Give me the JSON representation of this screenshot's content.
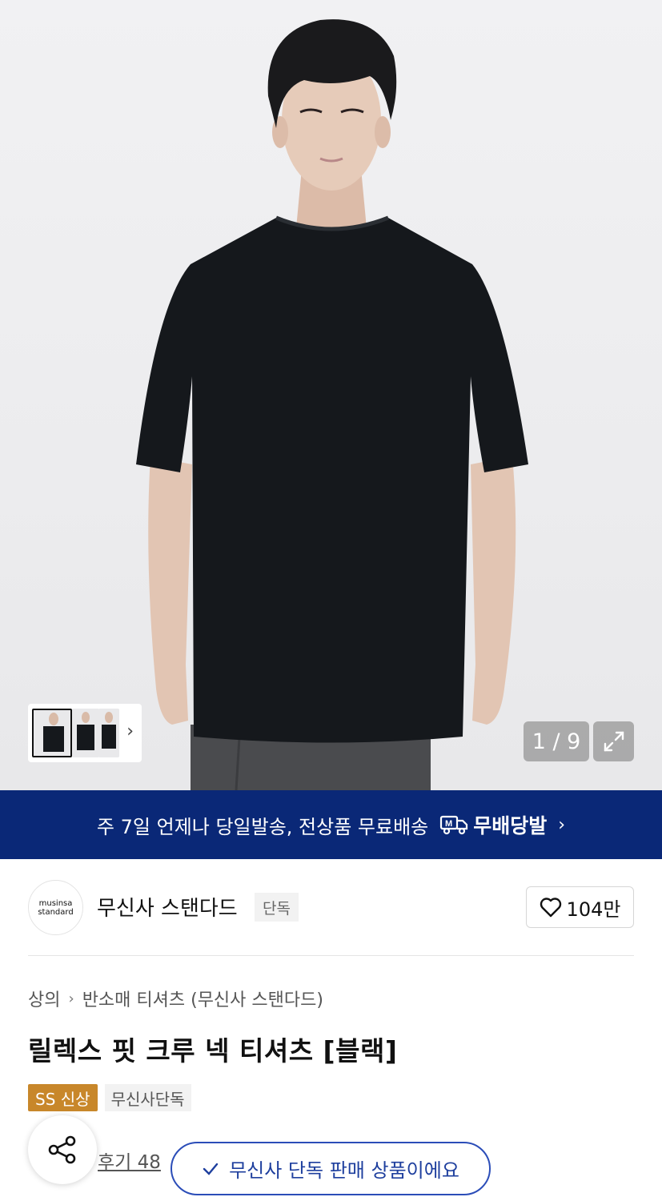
{
  "gallery": {
    "counter": "1 / 9",
    "icons": {
      "next": "chevron-right-icon",
      "expand": "expand-icon"
    }
  },
  "banner": {
    "text": "주 7일 언제나 당일발송, 전상품 무료배송",
    "badge_label": "무배당발",
    "badge_icon": "delivery-truck-icon",
    "arrow": "›",
    "bg_color": "#0a2877"
  },
  "brand": {
    "logo_line1": "musinsa",
    "logo_line2": "standard",
    "name": "무신사 스탠다드",
    "tag": "단독"
  },
  "like": {
    "icon": "heart-icon",
    "count": "104만"
  },
  "breadcrumb": {
    "root": "상의",
    "category": "반소매 티셔츠 (무신사 스탠다드)"
  },
  "product": {
    "title": "릴렉스 핏 크루 넥 티셔츠 [블랙]",
    "tags": [
      "SS 신상",
      "무신사단독"
    ],
    "new_tag_color": "#c8872a",
    "reviews": "후기 48"
  },
  "share": {
    "icon": "share-icon"
  },
  "toast": {
    "icon": "check-icon",
    "text": "무신사 단독 판매 상품이에요",
    "color": "#1e3f9e"
  }
}
